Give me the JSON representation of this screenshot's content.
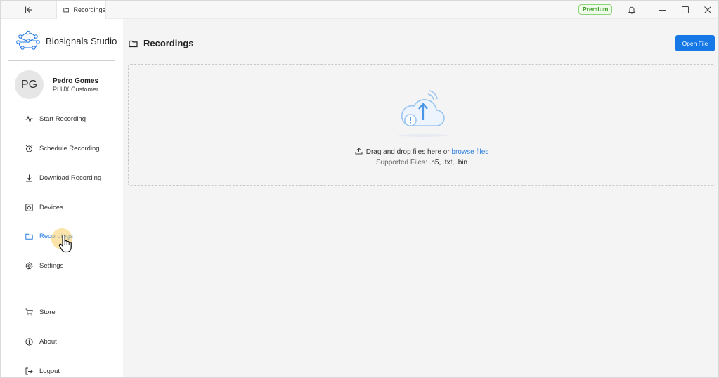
{
  "titlebar": {
    "tab_label": "Recordings",
    "premium_label": "Premium"
  },
  "sidebar": {
    "brand": "Biosignals Studio",
    "profile": {
      "initials": "PG",
      "name": "Pedro Gomes",
      "role": "PLUX Customer"
    },
    "items": [
      {
        "label": "Start Recording",
        "icon": "activity-icon"
      },
      {
        "label": "Schedule Recording",
        "icon": "clock-icon"
      },
      {
        "label": "Download Recording",
        "icon": "download-icon"
      },
      {
        "label": "Devices",
        "icon": "device-icon"
      },
      {
        "label": "Recordings",
        "icon": "folder-icon",
        "active": true
      },
      {
        "label": "Settings",
        "icon": "gear-icon"
      }
    ],
    "bottom_items": [
      {
        "label": "Store",
        "icon": "cart-icon"
      },
      {
        "label": "About",
        "icon": "info-icon"
      },
      {
        "label": "Logout",
        "icon": "logout-icon"
      }
    ]
  },
  "main": {
    "title": "Recordings",
    "open_file_label": "Open File",
    "dropzone": {
      "text_before": "Drag and drop files here or ",
      "link_text": "browse files",
      "supported_prefix": "Supported Files: ",
      "supported_ext": ".h5, .txt, .bin"
    }
  },
  "colors": {
    "accent": "#1677e6",
    "active_nav": "#2a7de1",
    "premium_green": "#3a9c24"
  }
}
